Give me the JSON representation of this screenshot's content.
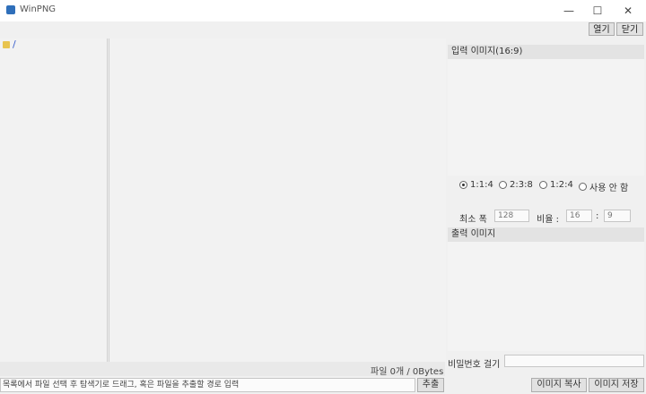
{
  "window": {
    "title": "WinPNG",
    "minimize": "—",
    "maximize": "☐",
    "close": "✕"
  },
  "toolbar": {
    "open_label": "열기",
    "close_label": "닫기"
  },
  "tree": {
    "root_label": "/",
    "root_icon": "folder-icon"
  },
  "right_panel": {
    "input_header": "입력 이미지(16:9)",
    "ratio_options": [
      {
        "label": "1:1:4",
        "selected": true
      },
      {
        "label": "2:3:8",
        "selected": false
      },
      {
        "label": "1:2:4",
        "selected": false
      },
      {
        "label": "사용 안 함",
        "selected": false
      }
    ],
    "min_width_label": "최소 폭",
    "min_width_value": "128",
    "ratio_label": "비율 :",
    "ratio_w": "16",
    "ratio_sep": ":",
    "ratio_h": "9",
    "output_header": "출력 이미지",
    "password_label": "비밀번호 걸기",
    "copy_image_button": "이미지 복사",
    "save_image_button": "이미지 저장"
  },
  "status": {
    "file_count_text": "파일 0개 / 0Bytes",
    "path_placeholder": "목록에서 파일 선택 후 탐색기로 드래그, 혹은 파일을 추출할 경로 입력",
    "extract_button": "추출"
  }
}
